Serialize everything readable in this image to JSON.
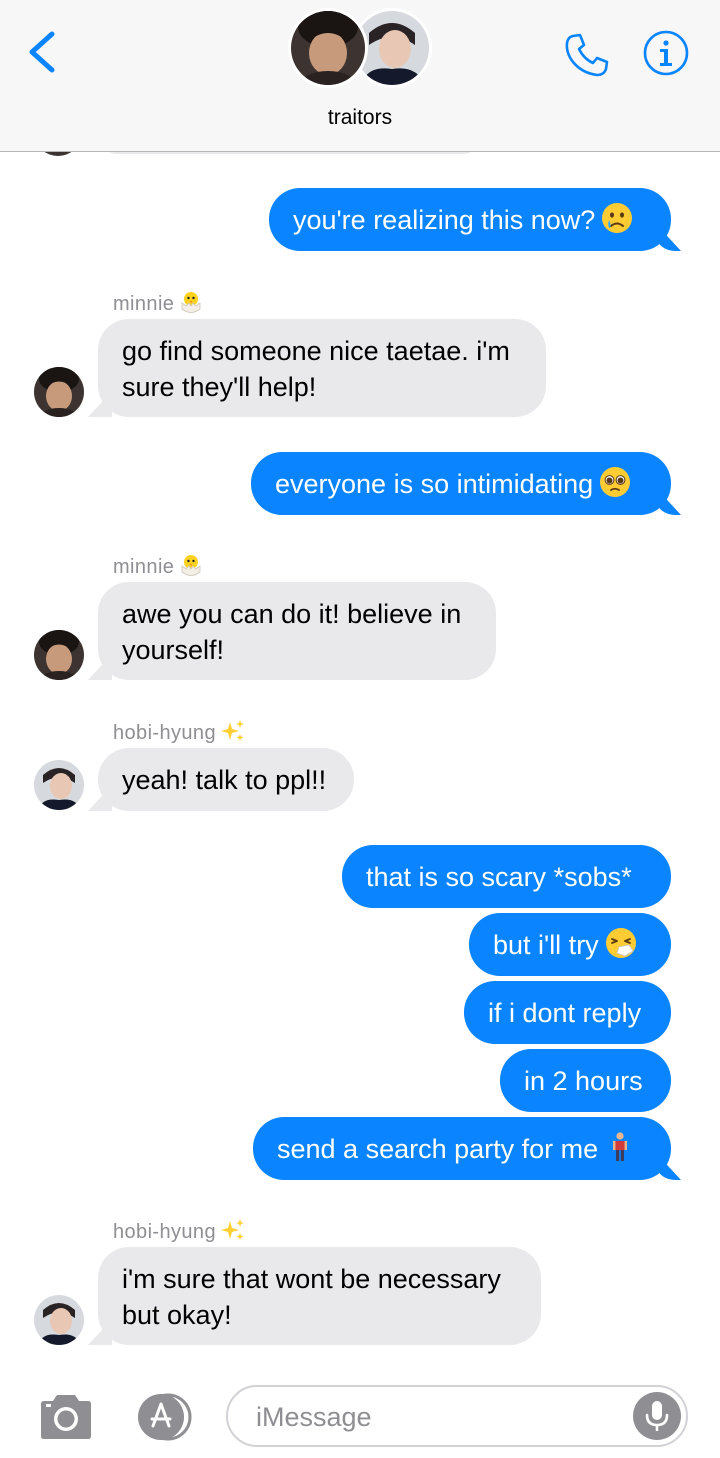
{
  "header": {
    "title": "traitors"
  },
  "messages": [
    {
      "text": "you're realizing this now?",
      "emoji": "crying-face"
    },
    {
      "sender": "minnie",
      "sender_emoji": "hatching-chick",
      "line1": "go find someone nice taetae. i'm",
      "line2": "sure they'll help!"
    },
    {
      "text": "everyone is so intimidating",
      "emoji": "pleading-face"
    },
    {
      "sender": "minnie",
      "sender_emoji": "hatching-chick",
      "line1": "awe you can do it! believe in",
      "line2": "yourself!"
    },
    {
      "sender": "hobi-hyung",
      "sender_emoji": "sparkles",
      "text": "yeah! talk to ppl!!"
    },
    {
      "text": "that is so scary *sobs*"
    },
    {
      "text": "but i'll try",
      "emoji": "sneezing-face"
    },
    {
      "text": "if i dont reply"
    },
    {
      "text": "in 2 hours"
    },
    {
      "text": "send a search party for me",
      "emoji": "person-standing"
    },
    {
      "sender": "hobi-hyung",
      "sender_emoji": "sparkles",
      "line1": "i'm sure that wont be necessary",
      "line2": "but okay!"
    }
  ],
  "input": {
    "placeholder": "iMessage"
  },
  "colors": {
    "accent": "#0b84ff",
    "incoming_bubble": "#e9e9eb",
    "sender_label": "#8e8e93"
  },
  "icons": [
    "back-chevron-icon",
    "phone-icon",
    "info-icon",
    "camera-icon",
    "app-store-icon",
    "microphone-icon"
  ]
}
